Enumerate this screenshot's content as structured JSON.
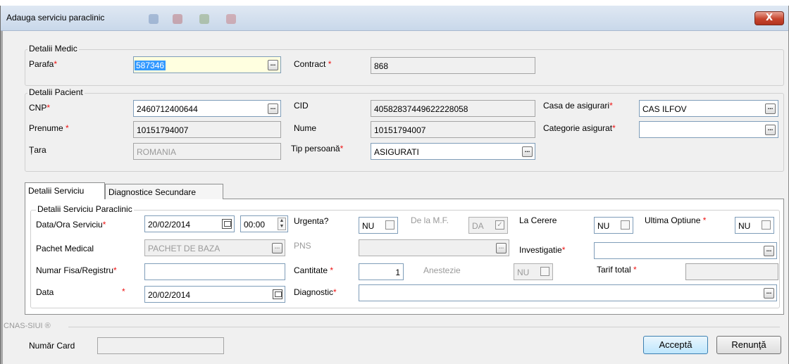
{
  "window": {
    "title": "Adauga serviciu paraclinic",
    "close_label": "X"
  },
  "medic": {
    "group_title": "Detalii Medic",
    "parafa_label": "Parafa",
    "parafa_value": "587346",
    "contract_label": "Contract",
    "contract_value": "868"
  },
  "pacient": {
    "group_title": "Detalii Pacient",
    "cnp_label": "CNP",
    "cnp_value": "2460712400644",
    "cid_label": "CID",
    "cid_value": "40582837449622228058",
    "casa_label": "Casa de asigurari",
    "casa_value": "CAS ILFOV",
    "prenume_label": "Prenume",
    "prenume_value": "10151794007",
    "nume_label": "Nume",
    "nume_value": "10151794007",
    "categorie_label": "Categorie asigurat",
    "categorie_value": "",
    "tara_label": "Țara",
    "tara_value": "ROMANIA",
    "tip_label": "Tip persoană",
    "tip_value": "ASIGURATI"
  },
  "tabs": [
    "Detalii Serviciu",
    "Diagnostice Secundare"
  ],
  "serviciu": {
    "group_title": "Detalii Serviciu Paraclinic",
    "data_ora_label": "Data/Ora Serviciu",
    "data_value": "20/02/2014",
    "ora_value": "00:00",
    "urgenta_label": "Urgenta?",
    "urgenta_value": "NU",
    "delamf_label": "De la M.F.",
    "delamf_value": "DA",
    "lacerere_label": "La Cerere",
    "lacerere_value": "NU",
    "ultima_label": "Ultima Optiune",
    "ultima_value": "NU",
    "pachet_label": "Pachet Medical",
    "pachet_value": "PACHET DE BAZA",
    "pns_label": "PNS",
    "pns_value": "",
    "investigatie_label": "Investigatie",
    "investigatie_value": "",
    "fisa_label": "Numar Fisa/Registru",
    "fisa_value": "",
    "cantitate_label": "Cantitate",
    "cantitate_value": "1",
    "anestezie_label": "Anestezie",
    "anestezie_value": "NU",
    "tarif_label": "Tarif total",
    "tarif_value": "",
    "data2_label": "Data",
    "data2_value": "20/02/2014",
    "diagnostic_label": "Diagnostic",
    "diagnostic_value": ""
  },
  "cnas": {
    "group_title": "CNAS-SIUI ®",
    "card_label": "Număr Card",
    "card_value": ""
  },
  "buttons": {
    "accept": "Acceptă",
    "cancel": "Renunţă"
  },
  "colors": {
    "accent": "#3399ff",
    "required": "#ee1111",
    "close": "#c7452e"
  },
  "icons": [
    "close-icon",
    "ellipsis-icon",
    "calendar-icon",
    "checkbox-icon",
    "spinner-icon"
  ]
}
